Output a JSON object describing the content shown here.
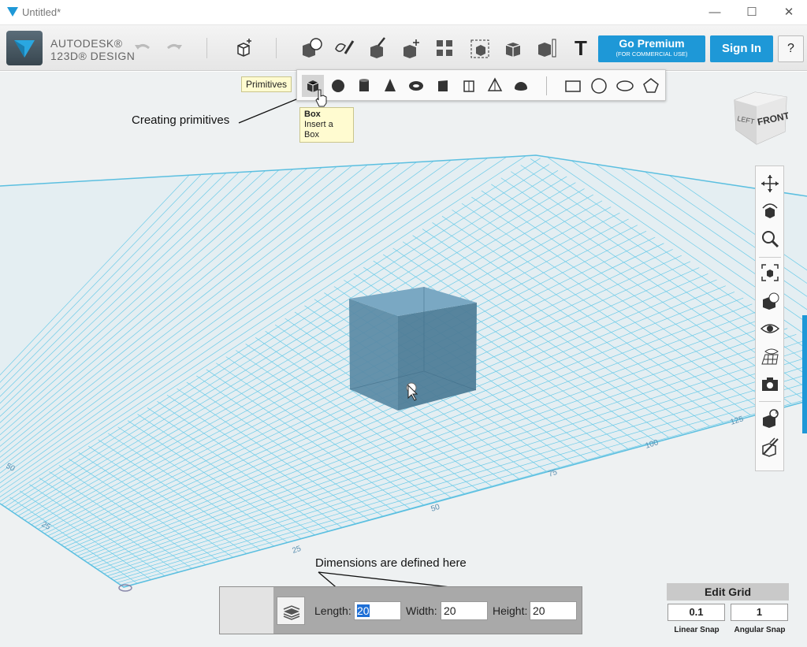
{
  "window": {
    "title": "Untitled*",
    "controls": {
      "minimize": "—",
      "maximize": "☐",
      "close": "✕"
    }
  },
  "brand": {
    "line1": "AUTODESK®",
    "line2": "123D® DESIGN"
  },
  "toolbar": {
    "premium_label": "Go Premium",
    "premium_sub": "(FOR COMMERCIAL USE)",
    "signin_label": "Sign In",
    "help_label": "?",
    "text_tool_label": "T"
  },
  "primitives": {
    "tooltip": "Primitives",
    "items": [
      "box",
      "sphere",
      "cylinder",
      "cone",
      "torus",
      "wedge",
      "prism",
      "pyramid",
      "hemisphere",
      "rectangle",
      "circle",
      "ellipse",
      "polygon"
    ]
  },
  "box_tooltip": {
    "title": "Box",
    "desc": "Insert a Box"
  },
  "annotations": {
    "primitives_note": "Creating primitives",
    "dimensions_note": "Dimensions are defined here"
  },
  "viewcube": {
    "left": "LEFT",
    "front": "FRONT"
  },
  "grid_labels": [
    "25",
    "50",
    "75",
    "100",
    "125",
    "25",
    "50"
  ],
  "dimensions": {
    "length_label": "Length:",
    "length_value": "20",
    "width_label": "Width:",
    "width_value": "20",
    "height_label": "Height:",
    "height_value": "20"
  },
  "edit_grid": {
    "title": "Edit Grid",
    "linear_snap_value": "0.1",
    "linear_snap_label": "Linear Snap",
    "angular_snap_value": "1",
    "angular_snap_label": "Angular Snap"
  },
  "colors": {
    "accent": "#1e98d7",
    "grid_line": "#6ccbe8",
    "box": "#5a8aa5"
  }
}
